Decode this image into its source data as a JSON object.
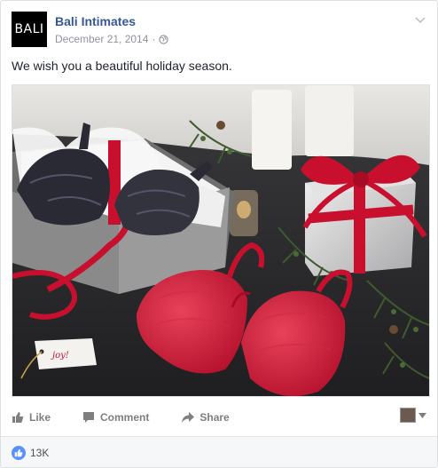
{
  "post": {
    "page_name": "Bali Intimates",
    "logo_text": "BALI",
    "date": "December 21, 2014",
    "privacy_separator": "·",
    "privacy_icon": "globe-icon",
    "menu_icon": "chevron-down-icon",
    "text": "We wish you a beautiful holiday season.",
    "photo": {
      "tag_text": "joy!"
    }
  },
  "actions": {
    "like_label": "Like",
    "comment_label": "Comment",
    "share_label": "Share"
  },
  "reactions": {
    "count": "13K"
  },
  "colors": {
    "link_blue": "#365899",
    "like_blue": "#5890ff",
    "accent_red": "#c8102e"
  }
}
